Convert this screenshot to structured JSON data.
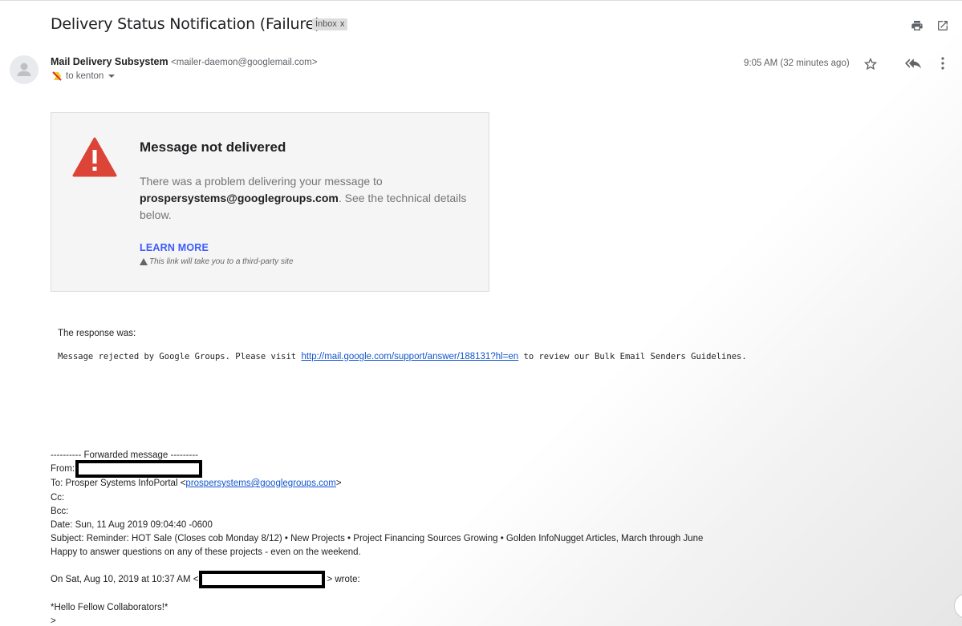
{
  "header": {
    "subject": "Delivery Status Notification (Failure)",
    "label": "Inbox",
    "label_close": "x"
  },
  "icons": {
    "print": "print-icon",
    "open_new_window": "open-in-new-window-icon",
    "star": "star-icon",
    "reply_all": "reply-all-icon",
    "more": "more-vert-icon",
    "avatar": "person-avatar-icon",
    "important": "important-marker-icon",
    "recipients": "chevron-down-icon",
    "warning": "warning-triangle-icon"
  },
  "message": {
    "sender_name": "Mail Delivery Subsystem",
    "sender_email": "<mailer-daemon@googlemail.com>",
    "to_line": "to kenton",
    "time": "9:05 AM (32 minutes ago)"
  },
  "card": {
    "title": "Message not delivered",
    "desc_before": "There was a problem delivering your message to ",
    "desc_address": "prospersystems@googlegroups.com",
    "desc_after": ". See the technical details below.",
    "learn_more": "LEARN MORE",
    "note": "This link will take you to a third-party site"
  },
  "response": {
    "label": "The response was:",
    "text_before": "Message rejected by Google Groups. Please visit ",
    "link": "http://mail.google.com/support/answer/188131?hl=en",
    "text_after": " to review our Bulk Email Senders Guidelines."
  },
  "forwarded": {
    "separator": "---------- Forwarded message ---------",
    "from_label": "From:",
    "to_before": "To: Prosper Systems InfoPortal <",
    "to_link": "prospersystems@googlegroups.com",
    "to_after": ">",
    "cc": "Cc:",
    "bcc": "Bcc:",
    "date": "Date: Sun, 11 Aug 2019 09:04:40 -0600",
    "subject": "Subject: Reminder: HOT Sale (Closes cob Monday 8/12) • New Projects • Project Financing Sources Growing • Golden InfoNugget Articles, March through June",
    "body_line": "Happy to answer questions on any of these projects - even on the weekend.",
    "quote_intro": "On Sat, Aug 10, 2019 at 10:37 AM <",
    "quote_end": "> wrote:",
    "greeting": "*Hello Fellow Collaborators!*",
    "quote_mark": ">"
  }
}
